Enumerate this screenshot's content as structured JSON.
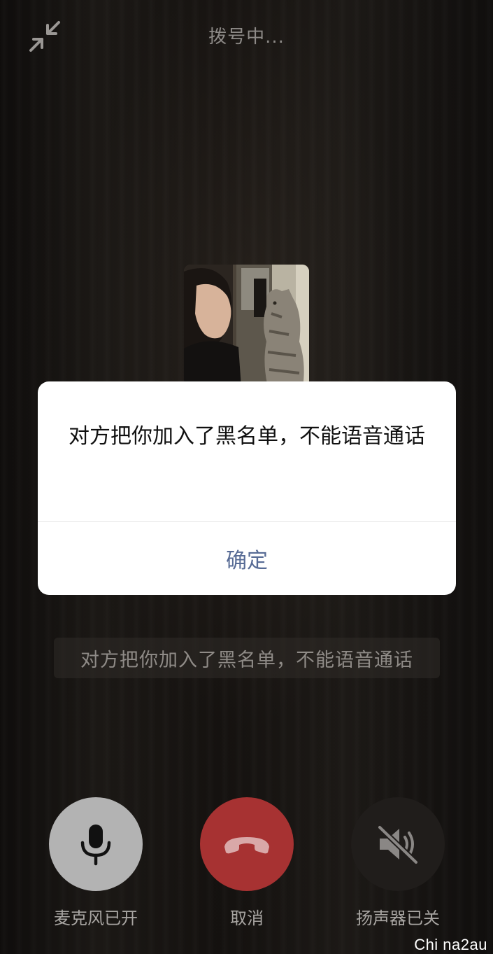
{
  "call": {
    "status": "拨号中..."
  },
  "dialog": {
    "message": "对方把你加入了黑名单，不能语音通话",
    "confirm_label": "确定"
  },
  "toast": {
    "text": "对方把你加入了黑名单，不能语音通话"
  },
  "controls": {
    "mic": {
      "label": "麦克风已开",
      "icon": "microphone-icon"
    },
    "hangup": {
      "label": "取消",
      "icon": "phone-hangup-icon"
    },
    "speaker": {
      "label": "扬声器已关",
      "icon": "speaker-muted-icon"
    }
  },
  "icons": {
    "minimize": "minimize-arrows-icon"
  },
  "watermark": "Chi na2au",
  "colors": {
    "hangup": "#a73232",
    "mic_bg": "#b3b3b3",
    "speaker_bg": "#201d1b",
    "dialog_action": "#576b95"
  }
}
